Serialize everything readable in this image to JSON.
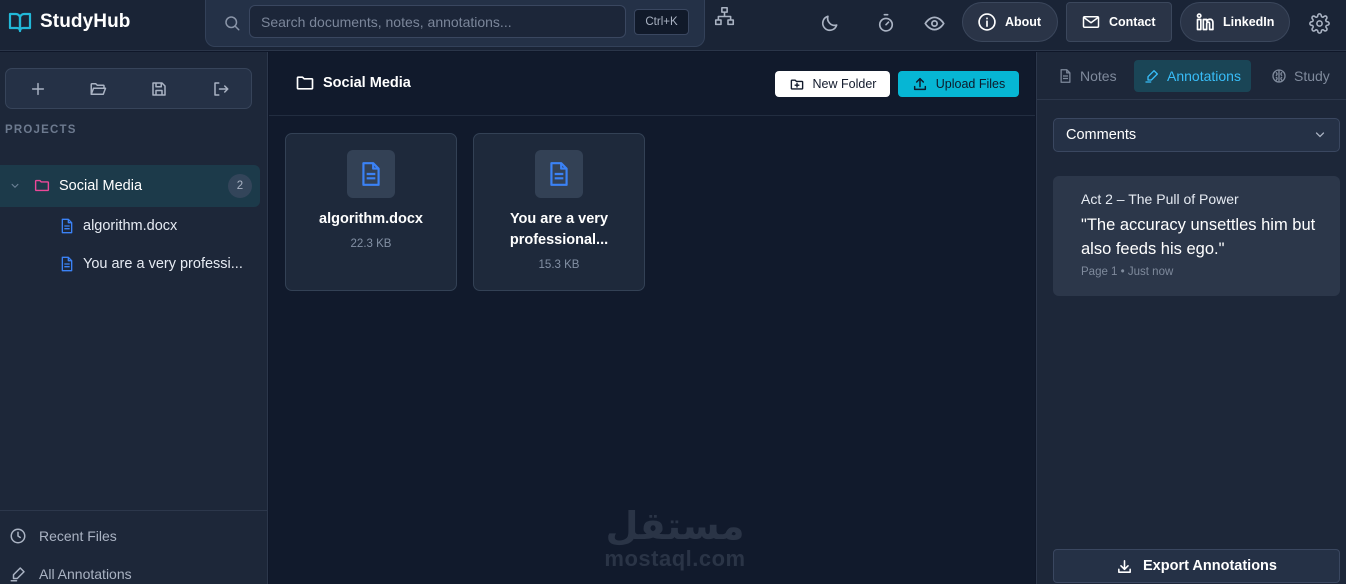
{
  "brand": {
    "name": "StudyHub"
  },
  "search": {
    "placeholder": "Search documents, notes, annotations...",
    "shortcut": "Ctrl+K"
  },
  "nav": {
    "about": "About",
    "contact": "Contact",
    "linkedin": "LinkedIn"
  },
  "sidebar": {
    "projects_label": "PROJECTS",
    "project": {
      "name": "Social Media",
      "count": "2"
    },
    "files": [
      {
        "name": "algorithm.docx"
      },
      {
        "name": "You are a very professi..."
      }
    ],
    "footer": {
      "recent": "Recent Files",
      "annotations": "All Annotations"
    }
  },
  "main": {
    "folder_title": "Social Media",
    "new_folder": "New Folder",
    "upload_files": "Upload Files",
    "cards": [
      {
        "name": "algorithm.docx",
        "size": "22.3 KB"
      },
      {
        "name": "You are a very professional...",
        "size": "15.3 KB"
      }
    ],
    "watermark": {
      "arabic": "مستقل",
      "latin": "mostaql.com"
    }
  },
  "panel": {
    "tabs": {
      "notes": "Notes",
      "annotations": "Annotations",
      "study": "Study"
    },
    "filter": "Comments",
    "annotation": {
      "title": "Act 2 – The Pull of Power",
      "quote": "\"The accuracy unsettles him but also feeds his ego.\"",
      "page": "Page 1",
      "time": "Just now"
    },
    "export": "Export Annotations"
  },
  "colors": {
    "accent": "#06b6d4",
    "active_tab": "#38bdf8",
    "folder": "#ec4899",
    "file_icon": "#3b82f6",
    "background": "#0f1729"
  }
}
